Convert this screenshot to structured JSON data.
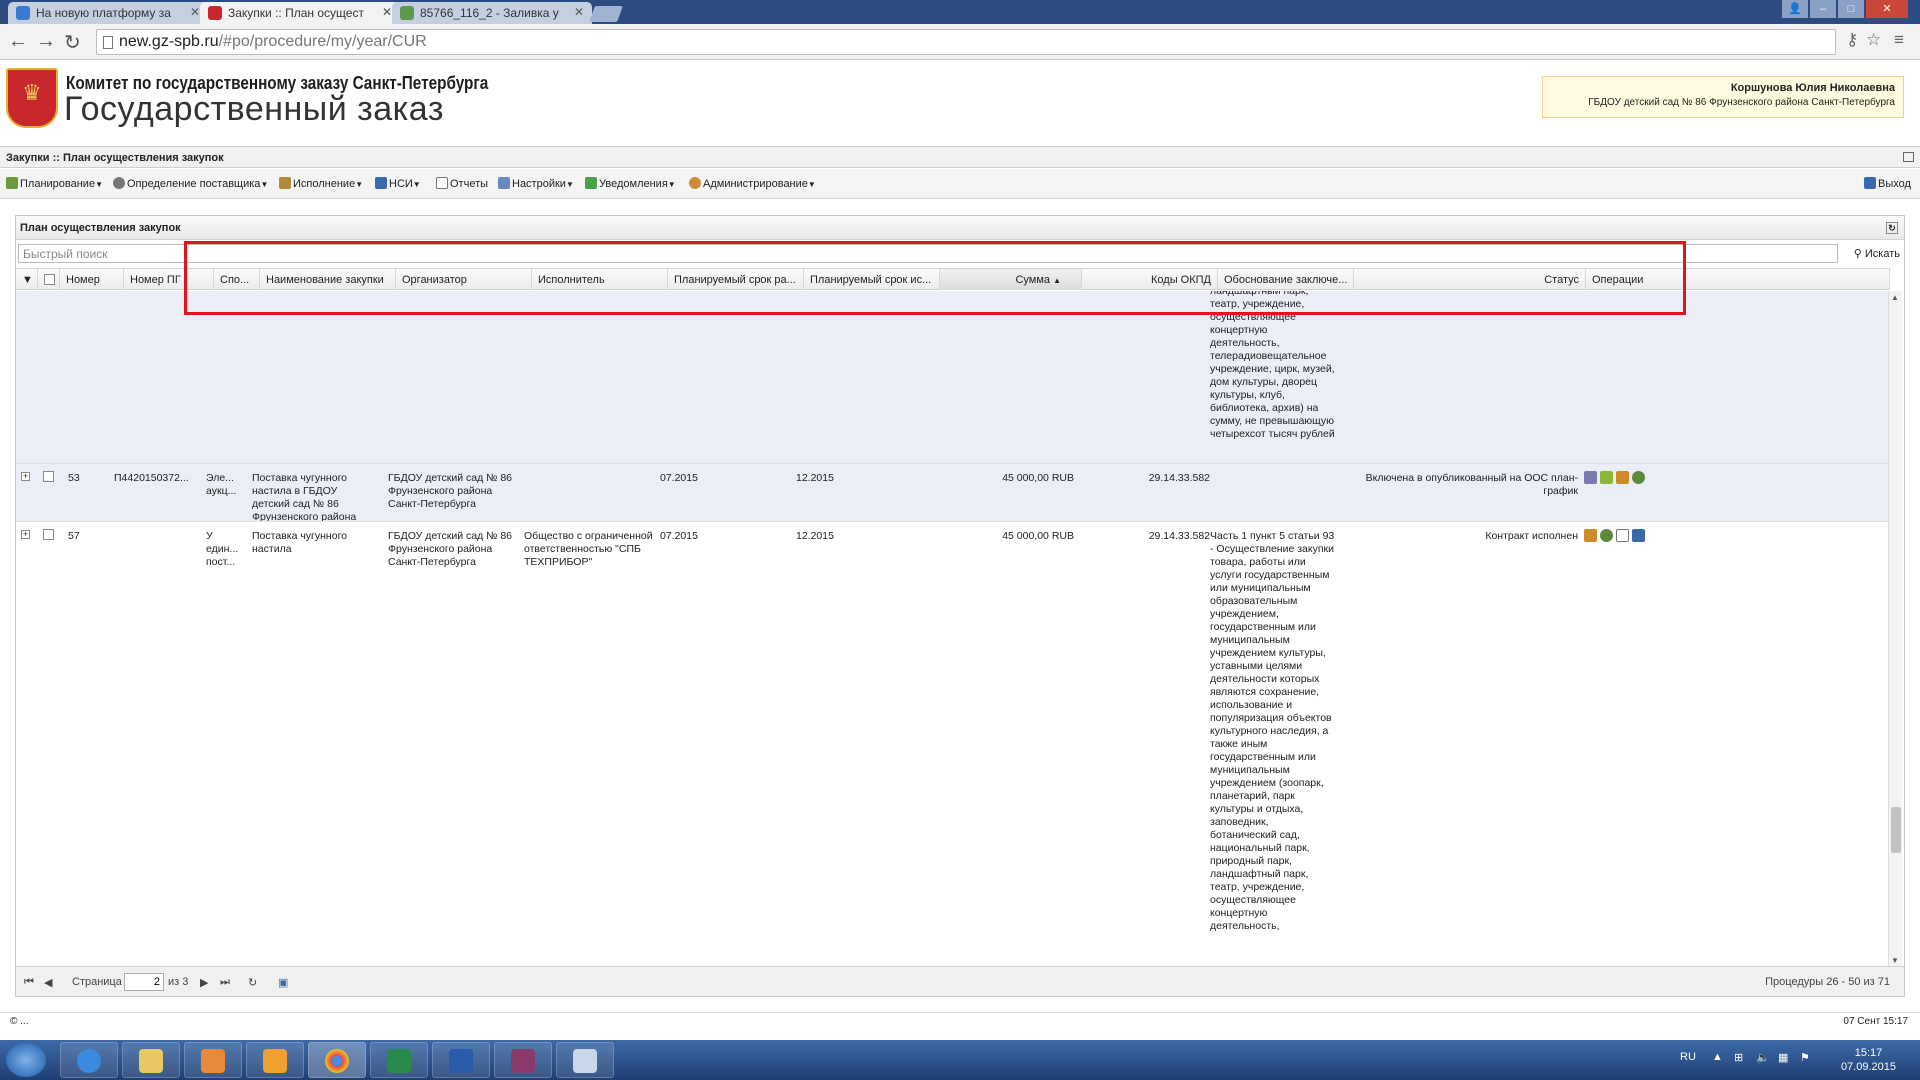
{
  "browser": {
    "tabs": [
      {
        "label": "На новую платформу за",
        "active": false
      },
      {
        "label": "Закупки :: План осущест",
        "active": true
      },
      {
        "label": "85766_116_2 - Заливка у",
        "active": false
      }
    ],
    "url_host": "new.gz-spb.ru",
    "url_path": "/#po/procedure/my/year/CUR"
  },
  "header": {
    "org_title": "Комитет по государственному заказу Санкт-Петербурга",
    "app_title": "Государственный заказ",
    "user_name": "Коршунова Юлия Николаевна",
    "user_org": "ГБДОУ детский сад № 86 Фрунзенского района Санкт-Петербурга"
  },
  "breadcrumb": "Закупки :: План осуществления закупок",
  "menu": {
    "items": [
      "Планирование",
      "Определение поставщика",
      "Исполнение",
      "НСИ",
      "Отчеты",
      "Настройки",
      "Уведомления",
      "Администрирование"
    ],
    "logout": "Выход"
  },
  "panel": {
    "title": "План осуществления закупок",
    "search_placeholder": "Быстрый поиск",
    "search_button": "Искать"
  },
  "columns": [
    "Номер",
    "Номер ПГ",
    "Спо...",
    "Наименование закупки",
    "Организатор",
    "Исполнитель",
    "Планируемый срок ра...",
    "Планируемый срок ис...",
    "Сумма",
    "Коды ОКПД",
    "Обоснование заключе...",
    "Статус",
    "Операции"
  ],
  "rows": {
    "top_partial": {
      "justification": "ландшафтный парк, театр, учреждение, осуществляющее концертную деятельность, телерадиовещательное учреждение, цирк, музей, дом культуры, дворец культуры, клуб, библиотека, архив) на сумму, не превышающую четырехсот тысяч рублей"
    },
    "row53": {
      "number": "53",
      "pg_number": "П4420150372...",
      "method": "Эле... аукц...",
      "name": "Поставка чугунного настила в ГБДОУ детский сад № 86 Фрунзенского района Санкт-Петербурга",
      "organizer": "ГБДОУ детский сад № 86 Фрунзенского района Санкт-Петербурга",
      "executor": "",
      "plan_start": "07.2015",
      "plan_end": "12.2015",
      "sum": "45 000,00 RUB",
      "okpd": "29.14.33.582",
      "justification": "",
      "status": "Включена в опубликованный на ООС план-график"
    },
    "row57": {
      "number": "57",
      "pg_number": "",
      "method": "У един... пост...",
      "name": "Поставка чугунного настила",
      "organizer": "ГБДОУ детский сад № 86 Фрунзенского района Санкт-Петербурга",
      "executor": "Общество с ограниченной ответственностью \"СПБ ТЕХПРИБОР\"",
      "plan_start": "07.2015",
      "plan_end": "12.2015",
      "sum": "45 000,00 RUB",
      "okpd": "29.14.33.582",
      "justification": "Часть 1 пункт 5 статьи 93 - Осуществление закупки товара, работы или услуги государственным или муниципальным образовательным учреждением, государственным или муниципальным учреждением культуры, уставными целями деятельности которых являются сохранение, использование и популяризация объектов культурного наследия, а также иным государственным или муниципальным учреждением (зоопарк, планетарий, парк культуры и отдыха, заповедник, ботанический сад, национальный парк, природный парк, ландшафтный парк, театр, учреждение, осуществляющее концертную деятельность,",
      "status": "Контракт исполнен"
    }
  },
  "pager": {
    "page_label": "Страница",
    "page_value": "2",
    "of_label": "из 3",
    "summary": "Процедуры 26 - 50 из 71"
  },
  "statusbar": {
    "left": "© ...",
    "right": "07 Сент 15:17"
  },
  "taskbar": {
    "lang": "RU",
    "time": "15:17",
    "date": "07.09.2015"
  },
  "colors": {
    "highlight": "#e0141e",
    "alt_row": "#ebedf7",
    "taskbar": "#2a5088"
  }
}
